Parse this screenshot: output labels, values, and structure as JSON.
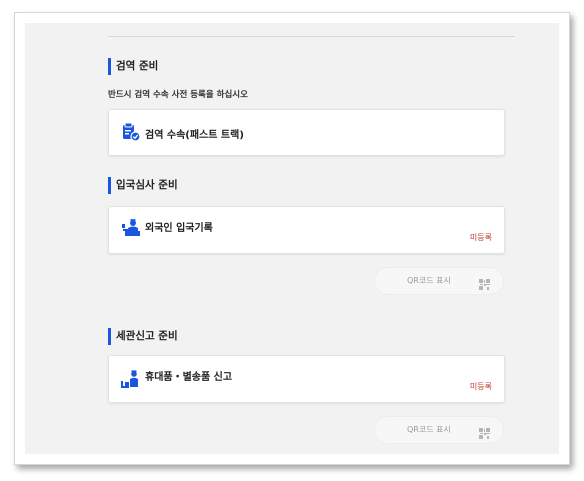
{
  "quarantine": {
    "title": "검역 준비",
    "subtitle": "반드시 검역 수속 사전 등록을 하십시오",
    "card": {
      "label": "검역 수속(패스트 트랙)",
      "icon": "document-check-icon"
    }
  },
  "immigration": {
    "title": "입국심사 준비",
    "card": {
      "label": "외국인 입국기록",
      "status": "미등록",
      "icon": "officer-desk-icon"
    },
    "qr_button": {
      "label": "QR코드 표시",
      "icon": "qr-code-icon"
    }
  },
  "customs": {
    "title": "세관신고 준비",
    "card": {
      "label": "휴대품・별송품 신고",
      "status": "미등록",
      "icon": "customs-officer-icon"
    },
    "qr_button": {
      "label": "QR코드 표시",
      "icon": "qr-code-icon"
    }
  },
  "colors": {
    "accent": "#1a55e0",
    "status_unregistered": "#c0392b",
    "panel_background": "#f2f2f2"
  }
}
